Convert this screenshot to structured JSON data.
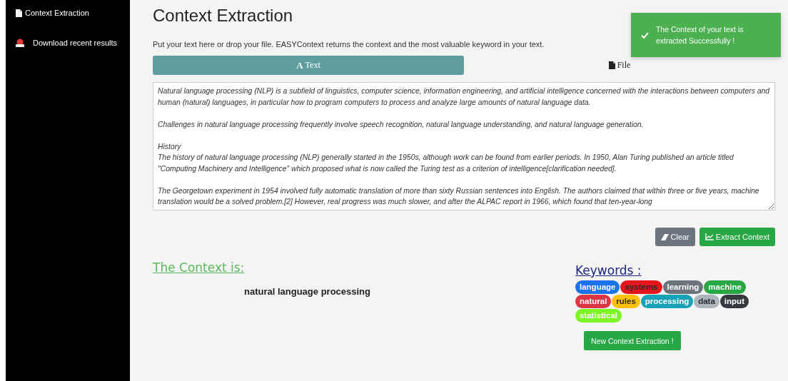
{
  "sidebar": {
    "items": [
      {
        "label": "Context Extraction",
        "kind": "document"
      },
      {
        "label": "Download recent results",
        "kind": "download"
      }
    ]
  },
  "title": "Context Extraction",
  "description": "Put your text here or drop your file. EASYContext returns the context and the most valuable keyword in your text.",
  "tabs": [
    {
      "icon": "A",
      "label": "Text",
      "selected": true
    },
    {
      "label": "File",
      "selected": false
    }
  ],
  "text_input": {
    "value": "Natural language processing (NLP) is a subfield of linguistics, computer science, information engineering, and artificial intelligence concerned with the interactions between computers and human (natural) languages, in particular how to program computers to process and analyze large amounts of natural language data.\n\nChallenges in natural language processing frequently involve speech recognition, natural language understanding, and natural language generation.\n\nHistory\nThe history of natural language processing (NLP) generally started in the 1950s, although work can be found from earlier periods. In 1950, Alan Turing published an article titled \"Computing Machinery and Intelligence\" which proposed what is now called the Turing test as a criterion of intelligence[clarification needed].\n\nThe Georgetown experiment in 1954 involved fully automatic translation of more than sixty Russian sentences into English. The authors claimed that within three or five years, machine translation would be a solved problem.[2] However, real progress was much slower, and after the ALPAC report in 1966, which found that ten-year-long"
  },
  "buttons": [
    {
      "label": "Clear",
      "kind": "clear"
    },
    {
      "label": "Extract Context",
      "kind": "extract"
    }
  ],
  "context": {
    "heading": "The Context is:",
    "result": "natural language processing"
  },
  "keywords": {
    "heading": "Keywords :",
    "items": [
      {
        "label": "language",
        "color": "#1a73e8",
        "kind": "light"
      },
      {
        "label": "systems",
        "color": "#e3161b",
        "kind": "dark"
      },
      {
        "label": "learning",
        "color": "#6c757d",
        "kind": "light"
      },
      {
        "label": "machine",
        "color": "#28a745",
        "kind": "light"
      },
      {
        "label": "natural",
        "color": "#dc3545",
        "kind": "light"
      },
      {
        "label": "rules",
        "color": "#ffc107",
        "kind": "dark"
      },
      {
        "label": "processing",
        "color": "#17a2b8",
        "kind": "light"
      },
      {
        "label": "data",
        "color": "#adb5bd",
        "kind": "dark"
      },
      {
        "label": "input",
        "color": "#343a40",
        "kind": "light"
      },
      {
        "label": "statistical",
        "color": "#7cf425",
        "kind": "light"
      }
    ]
  },
  "new_button": "New Context Extraction !",
  "toast": {
    "message": "The Context of your text is extracted Successfully !"
  }
}
